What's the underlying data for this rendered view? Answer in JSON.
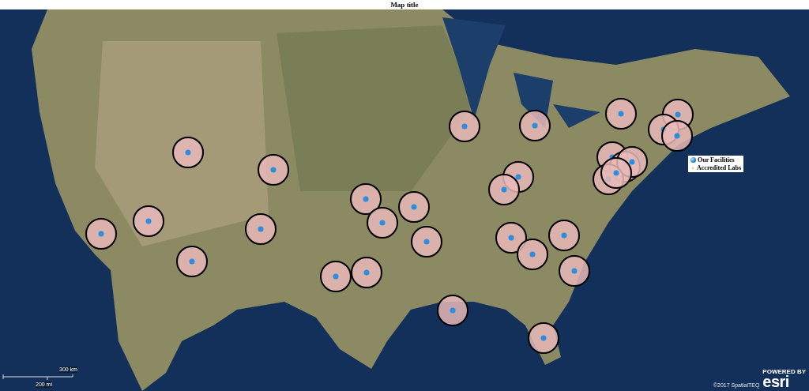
{
  "title": "Map title",
  "legend": [
    {
      "kind": "marker",
      "label": "Our Facilities"
    },
    {
      "kind": "dot",
      "label": "Accredited Labs"
    }
  ],
  "scale_bar": {
    "top_label": "300 km",
    "bottom_label": "200 mi"
  },
  "credit": "©2017 SpatialTEQ",
  "logo": {
    "tagline": "POWERED BY",
    "name": "esri"
  }
}
